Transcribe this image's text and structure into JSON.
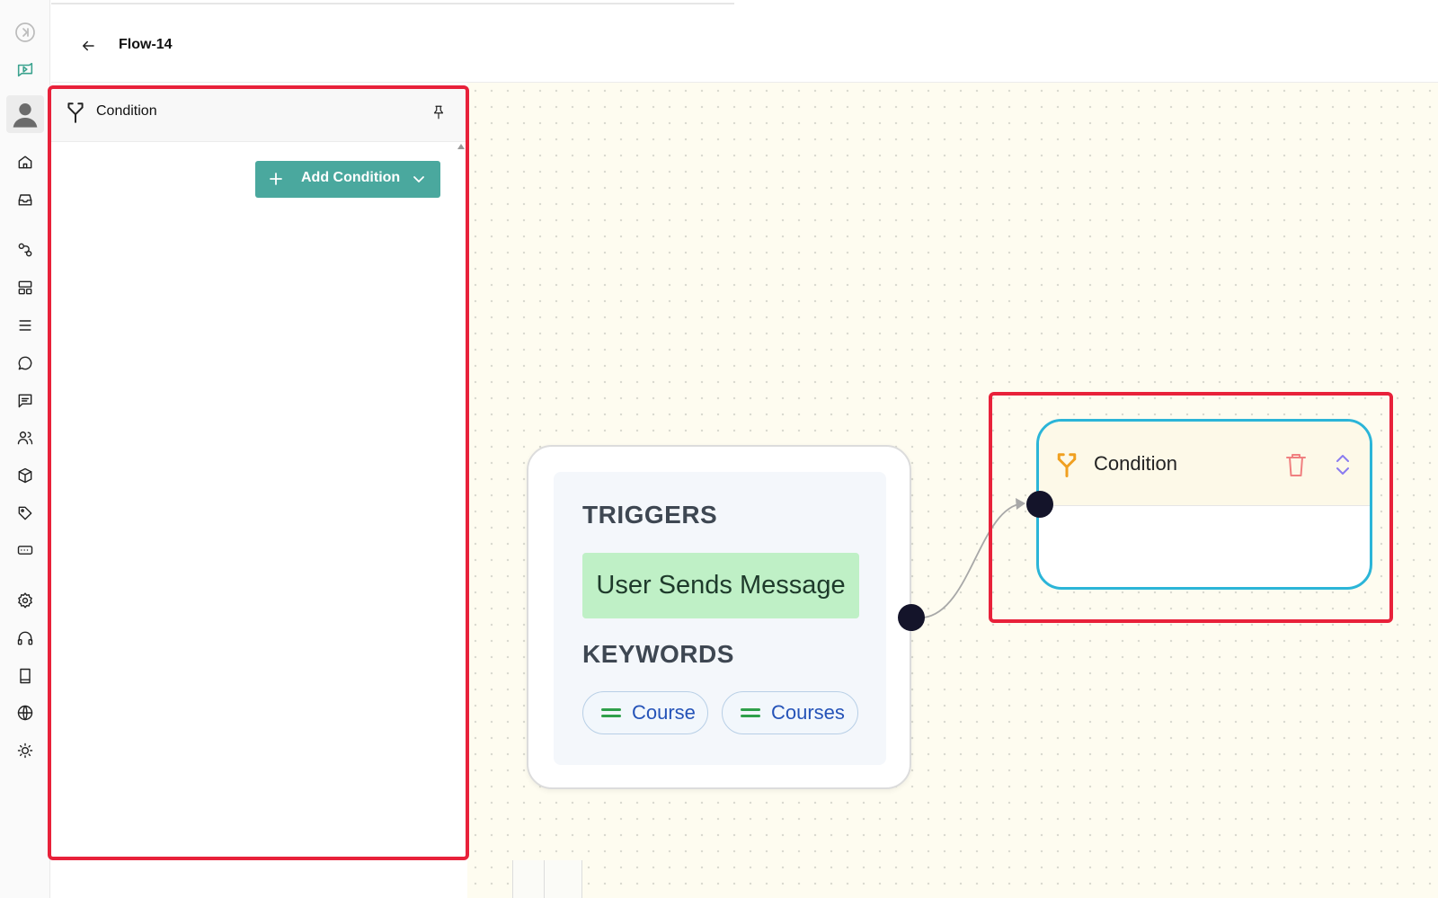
{
  "app": {
    "flow_title": "Flow-14"
  },
  "rail": {
    "items": [
      {
        "icon": "collapse-icon"
      },
      {
        "icon": "flow-builder-icon"
      },
      {
        "icon": "avatar-icon"
      },
      {
        "icon": "home-icon"
      },
      {
        "icon": "inbox-icon"
      },
      {
        "icon": "workflow-icon"
      },
      {
        "icon": "layout-icon"
      },
      {
        "icon": "list-icon"
      },
      {
        "icon": "chat-bubble-icon"
      },
      {
        "icon": "message-square-icon"
      },
      {
        "icon": "users-icon"
      },
      {
        "icon": "box-icon"
      },
      {
        "icon": "tag-icon"
      },
      {
        "icon": "card-icon"
      },
      {
        "icon": "settings-icon"
      },
      {
        "icon": "headphones-icon"
      },
      {
        "icon": "book-icon"
      },
      {
        "icon": "globe-icon"
      },
      {
        "icon": "sun-icon"
      }
    ]
  },
  "panel": {
    "title": "Condition",
    "add_condition_label": "Add Condition"
  },
  "canvas": {
    "trigger_node": {
      "triggers_heading": "TRIGGERS",
      "trigger": "User Sends Message",
      "keywords_heading": "KEYWORDS",
      "keywords": [
        "Course",
        "Courses"
      ]
    },
    "condition_node": {
      "title": "Condition"
    }
  },
  "colors": {
    "accent": "#4aa89e",
    "highlight": "#e8213a",
    "node_border": "#2bb5d8",
    "trigger_pill": "#bff0c6",
    "condition_icon": "#f0a020"
  }
}
